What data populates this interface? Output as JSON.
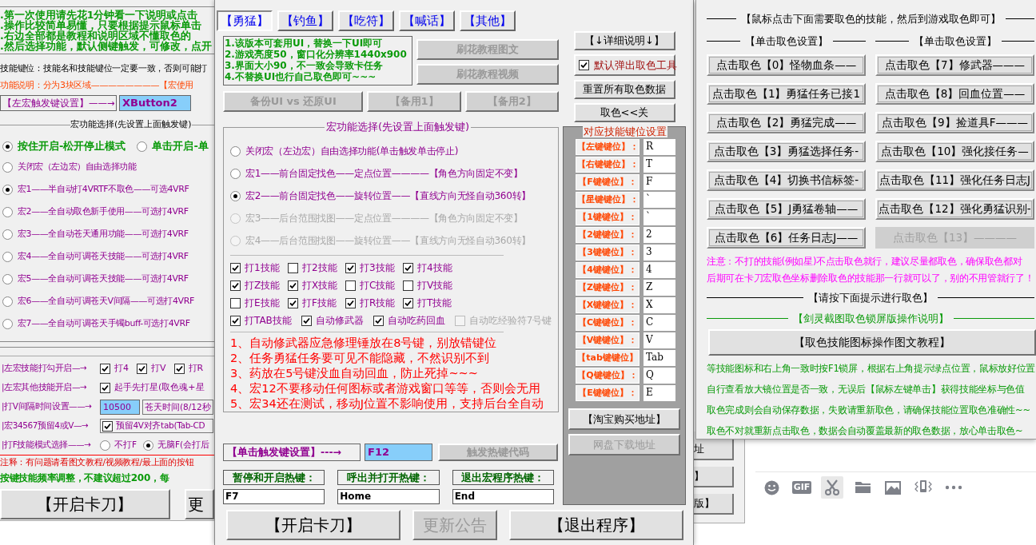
{
  "left_window": {
    "notes": [
      ".第一次使用请先花1分钟看一下说明或点击",
      ".操作比较简单易懂，只要根据提示鼠标单击",
      ".右边全部都是教程和说明区域不懂取色的",
      ".然后选择功能，默认侧键触发，可修改，点开"
    ],
    "key_hint": "技能键位：技能名和技能键位一定要一致，否则可能打",
    "section_label": "功能说明：分为3块区域————————【宏使用",
    "trigger": {
      "label": "【左宏触发键设置】——→",
      "value": "XButton2"
    },
    "group_title": "宏功能选择(先设置上面触发键)",
    "modes": [
      {
        "label": "按住开启-松开停止模式",
        "selected": true
      },
      {
        "label": "单击开启-单",
        "selected": false
      }
    ],
    "macros": [
      {
        "label": "关闭宏（左边宏）自由选择功能",
        "selected": false
      },
      {
        "label": "宏1——半自动打4VRTF不取色——可选4VRF",
        "selected": true
      },
      {
        "label": "宏2——全自动取色新手使用——可选打4VRF",
        "selected": false
      },
      {
        "label": "宏3——全自动苍天通用功能——可选打4VRF",
        "selected": false
      },
      {
        "label": "宏4——全自动可调苍天技能——可选打4VRF",
        "selected": false
      },
      {
        "label": "宏5——全自动可调苍天技能——可选打4VRF",
        "selected": false
      },
      {
        "label": "宏6——全自动可调苍天V间隔——可选打4VRF",
        "selected": false
      },
      {
        "label": "宏7——全自动可调苍天手镯buff-可选打4VRF",
        "selected": false
      }
    ],
    "option_rows": [
      {
        "kind": "checks",
        "label": "|左宏技能打勾开启—→",
        "items": [
          {
            "label": "打4",
            "checked": true
          },
          {
            "label": "打V",
            "checked": true
          },
          {
            "label": "打R",
            "checked": true
          }
        ]
      },
      {
        "kind": "checks",
        "label": "|左宏其他技能开启—→",
        "items": [
          {
            "label": "起手先打星(取色魂+星",
            "checked": true
          }
        ]
      },
      {
        "kind": "input",
        "label": "|打V间隔时间设置——→",
        "value": "10500",
        "note": "苍天时间(8/12秒"
      },
      {
        "kind": "boxed",
        "label": "|宏34567预留4或V—→",
        "items": [
          {
            "label": "预留4V对齐tab(Tab-CD",
            "checked": true
          }
        ]
      },
      {
        "kind": "radios",
        "label": "|打F技能模式选择——→",
        "items": [
          {
            "label": "不打F",
            "selected": false
          },
          {
            "label": "无脑F(会打后",
            "selected": true
          }
        ]
      }
    ],
    "comment": "注释：有问题请看图文教程/视频教程/最上面的按钮",
    "frequency": "按键技能频率调整，不建议超过200，每",
    "buttons": [
      {
        "label": "【开启卡刀】"
      },
      {
        "label": "更"
      }
    ]
  },
  "main_window": {
    "tabs": [
      {
        "label": "【勇猛】",
        "selected": true
      },
      {
        "label": "【钓鱼】",
        "selected": false
      },
      {
        "label": "【吃符】",
        "selected": false
      },
      {
        "label": "【喊话】",
        "selected": false
      },
      {
        "label": "【其他】",
        "selected": false
      }
    ],
    "tips": [
      "1.该版本可套用UI，替换一下UI即可",
      "2.游戏亮度50，窗口化分辨率1440x900",
      "3.界面大小90，不一致会导致卡任务",
      "4.不替换UI也行自己取色即可~~~"
    ],
    "tutorial_buttons": [
      {
        "label": "刷花教程图文",
        "disabled": true
      },
      {
        "label": "刷花教程视频",
        "disabled": true
      }
    ],
    "backup_buttons": [
      {
        "label": "备份UI vs 还原UI",
        "disabled": true
      },
      {
        "label": "【备用1】",
        "disabled": true
      },
      {
        "label": "【备用2】",
        "disabled": true
      }
    ],
    "side_controls": [
      {
        "kind": "button",
        "label": "【↓详细说明↓】"
      },
      {
        "kind": "checkbox",
        "label": "默认弹出取色工具",
        "checked": true
      },
      {
        "kind": "button",
        "label": "重置所有取色数据"
      },
      {
        "kind": "button",
        "label": "取色<<关"
      }
    ],
    "group": {
      "title": "宏功能选择(先设置上面触发键)",
      "macros": [
        {
          "label": "关闭宏（左边宏）自由选择功能(单击触发单击停止)",
          "selected": false,
          "disabled": false
        },
        {
          "label": "宏1——前台固定找色——定点位置————【角色方向固定不变】",
          "selected": false,
          "disabled": false
        },
        {
          "label": "宏2——前台固定找色——旋转位置——【直线方向无怪自动360转】",
          "selected": true,
          "disabled": false
        },
        {
          "label": "宏3——后台范围找图——定点位置————【角色方向固定不变】",
          "selected": false,
          "disabled": true
        },
        {
          "label": "宏4——后台范围找图——旋转位置——【直线方向无怪自动360转】",
          "selected": false,
          "disabled": true
        }
      ],
      "skills": [
        {
          "label": "打1技能",
          "checked": true,
          "disabled": false
        },
        {
          "label": "打2技能",
          "checked": false,
          "disabled": false
        },
        {
          "label": "打3技能",
          "checked": true,
          "disabled": false
        },
        {
          "label": "打4技能",
          "checked": true,
          "disabled": false
        },
        {
          "label": "打Z技能",
          "checked": true,
          "disabled": false
        },
        {
          "label": "打X技能",
          "checked": true,
          "disabled": false
        },
        {
          "label": "打C技能",
          "checked": false,
          "disabled": false
        },
        {
          "label": "打V技能",
          "checked": false,
          "disabled": false
        },
        {
          "label": "打E技能",
          "checked": false,
          "disabled": false
        },
        {
          "label": "打F技能",
          "checked": true,
          "disabled": false
        },
        {
          "label": "打R技能",
          "checked": true,
          "disabled": false
        },
        {
          "label": "打T技能",
          "checked": true,
          "disabled": false
        },
        {
          "label": "打TAB技能",
          "checked": true,
          "disabled": false
        },
        {
          "label": "自动修武器",
          "checked": true,
          "disabled": false
        },
        {
          "label": "自动吃药回血",
          "checked": true,
          "disabled": false
        },
        {
          "label": "自动吃经验符7号键",
          "checked": false,
          "disabled": true
        }
      ],
      "notes": [
        "1、自动修武器应急修理锤放在8号键，别放错键位",
        "2、任务勇猛任务要可见不能隐藏，不然识别不到",
        "3、药放在5号键没血自动回血，防止死掉~~~",
        "4、宏12不要移动任何图标或者游戏窗口等等，否则会无用",
        "5、宏34还在测试，移动J位置不影响使用，支持后台全自动"
      ]
    },
    "keys": {
      "title": "对应技能键位设置",
      "rows": [
        {
          "label": "【左键键位】：",
          "value": "R"
        },
        {
          "label": "【右键键位】：",
          "value": "T"
        },
        {
          "label": "【F键键位】：",
          "value": "F"
        },
        {
          "label": "【星键键位】：",
          "value": "`"
        },
        {
          "label": "【1键键位】：",
          "value": "`"
        },
        {
          "label": "【2键键位】：",
          "value": "2"
        },
        {
          "label": "【3键键位】：",
          "value": "3"
        },
        {
          "label": "【4键键位】：",
          "value": "4"
        },
        {
          "label": "【Z键键位】：",
          "value": "Z"
        },
        {
          "label": "【X键键位】：",
          "value": "X"
        },
        {
          "label": "【C键键位】：",
          "value": "C"
        },
        {
          "label": "【V键键位】：",
          "value": "V"
        },
        {
          "label": "【tab键键位】",
          "value": "Tab"
        },
        {
          "label": "【Q键键位】：",
          "value": "Q"
        },
        {
          "label": "【E键键位】：",
          "value": "E"
        }
      ],
      "buttons": [
        {
          "label": "【淘宝购买地址】",
          "disabled": false
        },
        {
          "label": "网盘下载地址",
          "disabled": true
        }
      ]
    },
    "click_trigger": {
      "label": "【单击触发键设置】---→",
      "value": "F12",
      "button": {
        "label": "触发热键代码",
        "disabled": true
      }
    },
    "hotkeys": [
      {
        "label": "暂停和开启热键：",
        "value": "F7"
      },
      {
        "label": "呼出并打开热键：",
        "value": "Home"
      },
      {
        "label": "退出宏程序热键：",
        "value": "End"
      }
    ],
    "bottom_buttons": [
      {
        "label": "【开启卡刀】",
        "disabled": false
      },
      {
        "label": "更新公告",
        "disabled": true
      },
      {
        "label": "【退出程序】",
        "disabled": false
      }
    ]
  },
  "color_window": {
    "heading": "【鼠标点击下面需要取色的技能，然后到游戏取色即可】",
    "columns": [
      {
        "title": "【单击取色设置】",
        "buttons": [
          {
            "label": "点击取色【0】怪物血条——",
            "disabled": false
          },
          {
            "label": "点击取色【1】勇猛任务已接1",
            "disabled": false
          },
          {
            "label": "点击取色【2】勇猛完成——",
            "disabled": false
          },
          {
            "label": "点击取色【3】勇猛选择任务-",
            "disabled": false
          },
          {
            "label": "点击取色【4】切换书信标签-",
            "disabled": false
          },
          {
            "label": "点击取色【5】J勇猛卷轴——",
            "disabled": false
          },
          {
            "label": "点击取色【6】任务日志J——",
            "disabled": false
          }
        ]
      },
      {
        "title": "【单击取色设置】",
        "buttons": [
          {
            "label": "点击取色【7】修武器———",
            "disabled": false
          },
          {
            "label": "点击取色【8】回血位置——",
            "disabled": false
          },
          {
            "label": "点击取色【9】捡道具F———",
            "disabled": false
          },
          {
            "label": "点击取色【10】强化接任务—",
            "disabled": false
          },
          {
            "label": "点击取色【11】强化任务日志J",
            "disabled": false
          },
          {
            "label": "点击取色【12】强化勇猛识别-",
            "disabled": false
          },
          {
            "label": "点击取色【13】————",
            "disabled": true
          }
        ]
      }
    ],
    "warning": [
      "注意：不打的技能(例如星)不点击取色就行，建议尽量都取色，确保取色都对",
      "后期可在卡刀宏取色坐标删除取色的技能那一行就可以了，别的不用管就行了！"
    ],
    "prompt": "【请按下面提示进行取色】",
    "guide_title": "【剑灵截图取色锁屏版操作说明】",
    "tutorial_button": "【取色技能图标操作图文教程】",
    "steps": [
      "等技能图标和右上角一致时按F1锁屏，根据右上角提示绿点位置，鼠标放好位置",
      "自行查看放大镜位置是否一致，无误后【鼠标左键单击】获得技能坐标与色值",
      "取色完成则会自动保存数据，失败请重新取色，请确保技能位置取色准确性~~",
      "取色不对就重新点击取色，数据会自动覆盖最新的取色数据，放心单击取色~"
    ]
  },
  "background_buttons": [
    {
      "label": "址"
    },
    {
      "label": "】"
    },
    {
      "label": "版】"
    }
  ],
  "chat_toolbar": [
    {
      "kind": "emoji",
      "selected": false
    },
    {
      "kind": "gif",
      "label": "GIF",
      "selected": false
    },
    {
      "kind": "screenshot",
      "selected": true
    },
    {
      "kind": "folder",
      "selected": false
    },
    {
      "kind": "image",
      "selected": false
    },
    {
      "kind": "shake",
      "selected": false
    },
    {
      "kind": "more",
      "selected": false
    }
  ]
}
